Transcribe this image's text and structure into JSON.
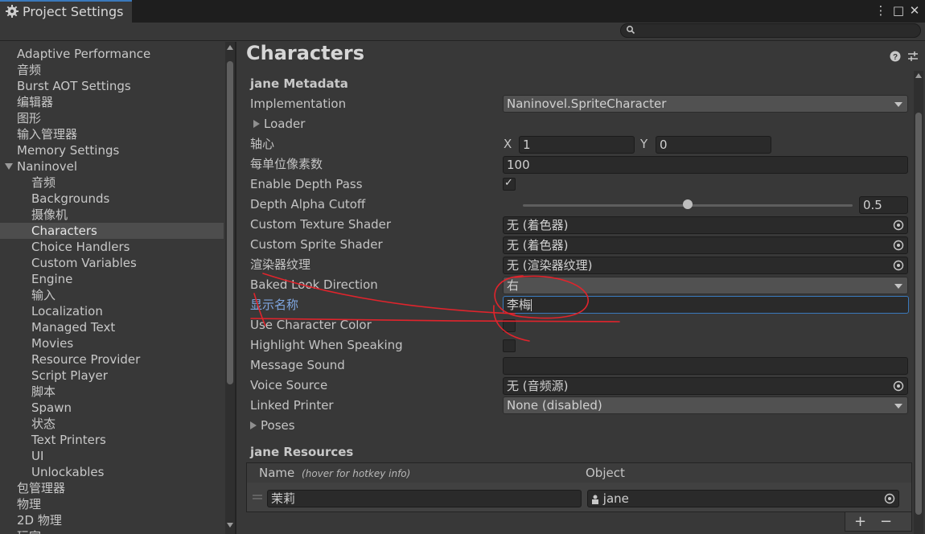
{
  "window": {
    "tab_title": "Project Settings",
    "tab_icon": "gear-icon",
    "menu_glyph": "⋮",
    "maximize_glyph": "□",
    "close_glyph": "✕"
  },
  "search": {
    "value": "",
    "icon": "search-icon"
  },
  "sidebar": {
    "items": [
      {
        "label": "Adaptive Performance"
      },
      {
        "label": "音频"
      },
      {
        "label": "Burst AOT Settings"
      },
      {
        "label": "编辑器"
      },
      {
        "label": "图形"
      },
      {
        "label": "输入管理器"
      },
      {
        "label": "Memory Settings"
      },
      {
        "label": "Naninovel",
        "expanded": true
      },
      {
        "label": "音频"
      },
      {
        "label": "Backgrounds"
      },
      {
        "label": "摄像机"
      },
      {
        "label": "Characters",
        "selected": true
      },
      {
        "label": "Choice Handlers"
      },
      {
        "label": "Custom Variables"
      },
      {
        "label": "Engine"
      },
      {
        "label": "输入"
      },
      {
        "label": "Localization"
      },
      {
        "label": "Managed Text"
      },
      {
        "label": "Movies"
      },
      {
        "label": "Resource Provider"
      },
      {
        "label": "Script Player"
      },
      {
        "label": "脚本"
      },
      {
        "label": "Spawn"
      },
      {
        "label": "状态"
      },
      {
        "label": "Text Printers"
      },
      {
        "label": "UI"
      },
      {
        "label": "Unlockables"
      },
      {
        "label": "包管理器"
      },
      {
        "label": "物理"
      },
      {
        "label": "2D 物理"
      },
      {
        "label": "玩家"
      }
    ]
  },
  "main": {
    "heading": "Characters",
    "help_icon": "help-icon",
    "settings_icon": "preset-icon",
    "metadata_title": "jane Metadata",
    "props": {
      "implementation": {
        "label": "Implementation",
        "value": "Naninovel.SpriteCharacter"
      },
      "loader": {
        "label": "Loader"
      },
      "pivot": {
        "label": "轴心",
        "x_label": "X",
        "x": "1",
        "y_label": "Y",
        "y": "0"
      },
      "ppu": {
        "label": "每单位像素数",
        "value": "100"
      },
      "depth_pass": {
        "label": "Enable Depth Pass",
        "checked": true,
        "check_glyph": "✓"
      },
      "depth_alpha": {
        "label": "Depth Alpha Cutoff",
        "value": "0.5",
        "fraction": 0.5
      },
      "tex_shader": {
        "label": "Custom Texture Shader",
        "value": "无 (着色器)"
      },
      "sprite_shader": {
        "label": "Custom Sprite Shader",
        "value": "无 (着色器)"
      },
      "renderer_tex": {
        "label": "渲染器纹理",
        "value": "无 (渲染器纹理)"
      },
      "look_dir": {
        "label": "Baked Look Direction",
        "value": "右"
      },
      "display_name": {
        "label": "显示名称",
        "value": "李梅"
      },
      "char_color": {
        "label": "Use Character Color",
        "checked": false
      },
      "highlight": {
        "label": "Highlight When Speaking",
        "checked": false
      },
      "message_sound": {
        "label": "Message Sound",
        "value": ""
      },
      "voice_source": {
        "label": "Voice Source",
        "value": "无 (音频源)"
      },
      "linked_printer": {
        "label": "Linked Printer",
        "value": "None (disabled)"
      },
      "poses": {
        "label": "Poses"
      }
    },
    "resources": {
      "title": "jane Resources",
      "col_name": "Name",
      "col_name_hint": "(hover for hotkey info)",
      "col_object": "Object",
      "rows": [
        {
          "name": "茉莉",
          "object": "jane"
        }
      ],
      "add_glyph": "+",
      "remove_glyph": "−"
    }
  },
  "colors": {
    "background": "#383838",
    "field": "#2a2a2a",
    "accent_blue": "#3a79bb",
    "annotation_red": "#e0242c"
  }
}
